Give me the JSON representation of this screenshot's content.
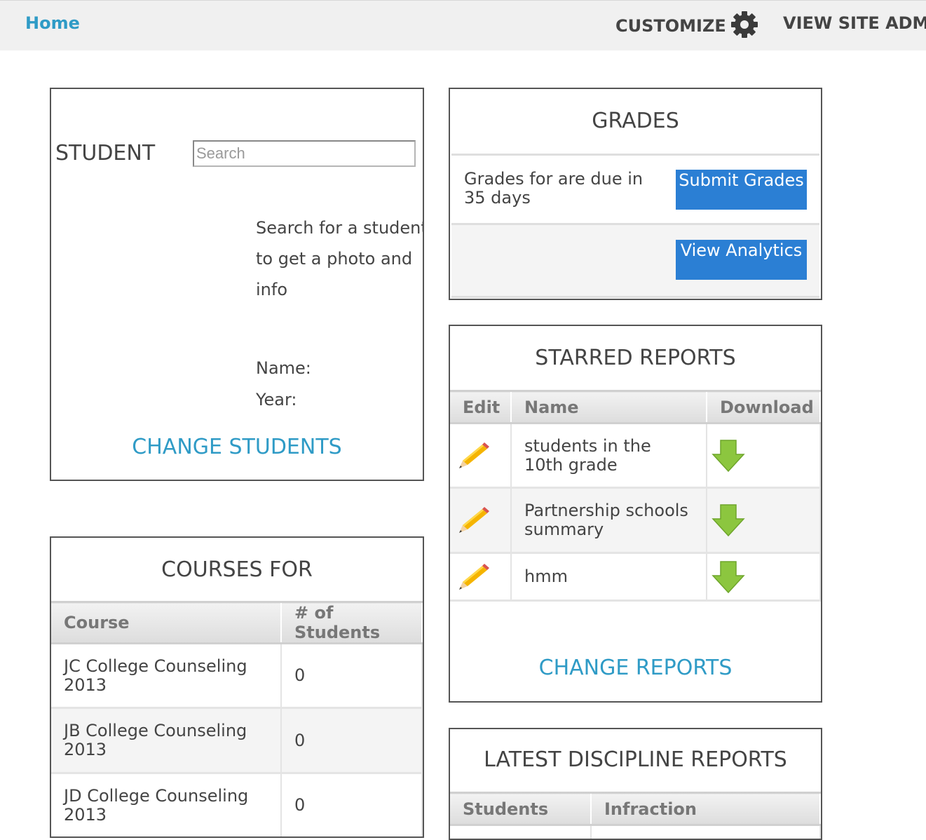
{
  "nav": {
    "home": "Home",
    "customize": "CUSTOMIZE",
    "site_admin": "VIEW SITE ADMIN"
  },
  "student": {
    "label": "STUDENT",
    "search_placeholder": "Search",
    "help_text": "Search for a student to get a photo and info",
    "name_label": "Name:",
    "year_label": "Year:",
    "change_link": "CHANGE STUDENTS"
  },
  "grades": {
    "title": "GRADES",
    "due_text": "Grades for are due in 35 days",
    "submit_label": "Submit Grades",
    "analytics_label": "View Analytics"
  },
  "starred_reports": {
    "title": "STARRED REPORTS",
    "headers": {
      "edit": "Edit",
      "name": "Name",
      "download": "Download"
    },
    "rows": [
      {
        "name": "students in the 10th grade"
      },
      {
        "name": "Partnership schools summary"
      },
      {
        "name": "hmm"
      }
    ],
    "change_link": "CHANGE REPORTS"
  },
  "courses": {
    "title": "COURSES FOR",
    "headers": {
      "course": "Course",
      "students": "# of Students"
    },
    "rows": [
      {
        "course": "JC College Counseling 2013",
        "students": "0"
      },
      {
        "course": "JB College Counseling 2013",
        "students": "0"
      },
      {
        "course": "JD College Counseling 2013",
        "students": "0"
      }
    ]
  },
  "discipline": {
    "title": "LATEST DISCIPLINE REPORTS",
    "headers": {
      "students": "Students",
      "infraction": "Infraction"
    }
  },
  "icons": {
    "settings": "gear-icon",
    "edit": "pencil-icon",
    "download": "download-arrow-icon"
  },
  "colors": {
    "link": "#2f9bc6",
    "button": "#2b7fd4",
    "download_arrow": "#8cc63f"
  }
}
